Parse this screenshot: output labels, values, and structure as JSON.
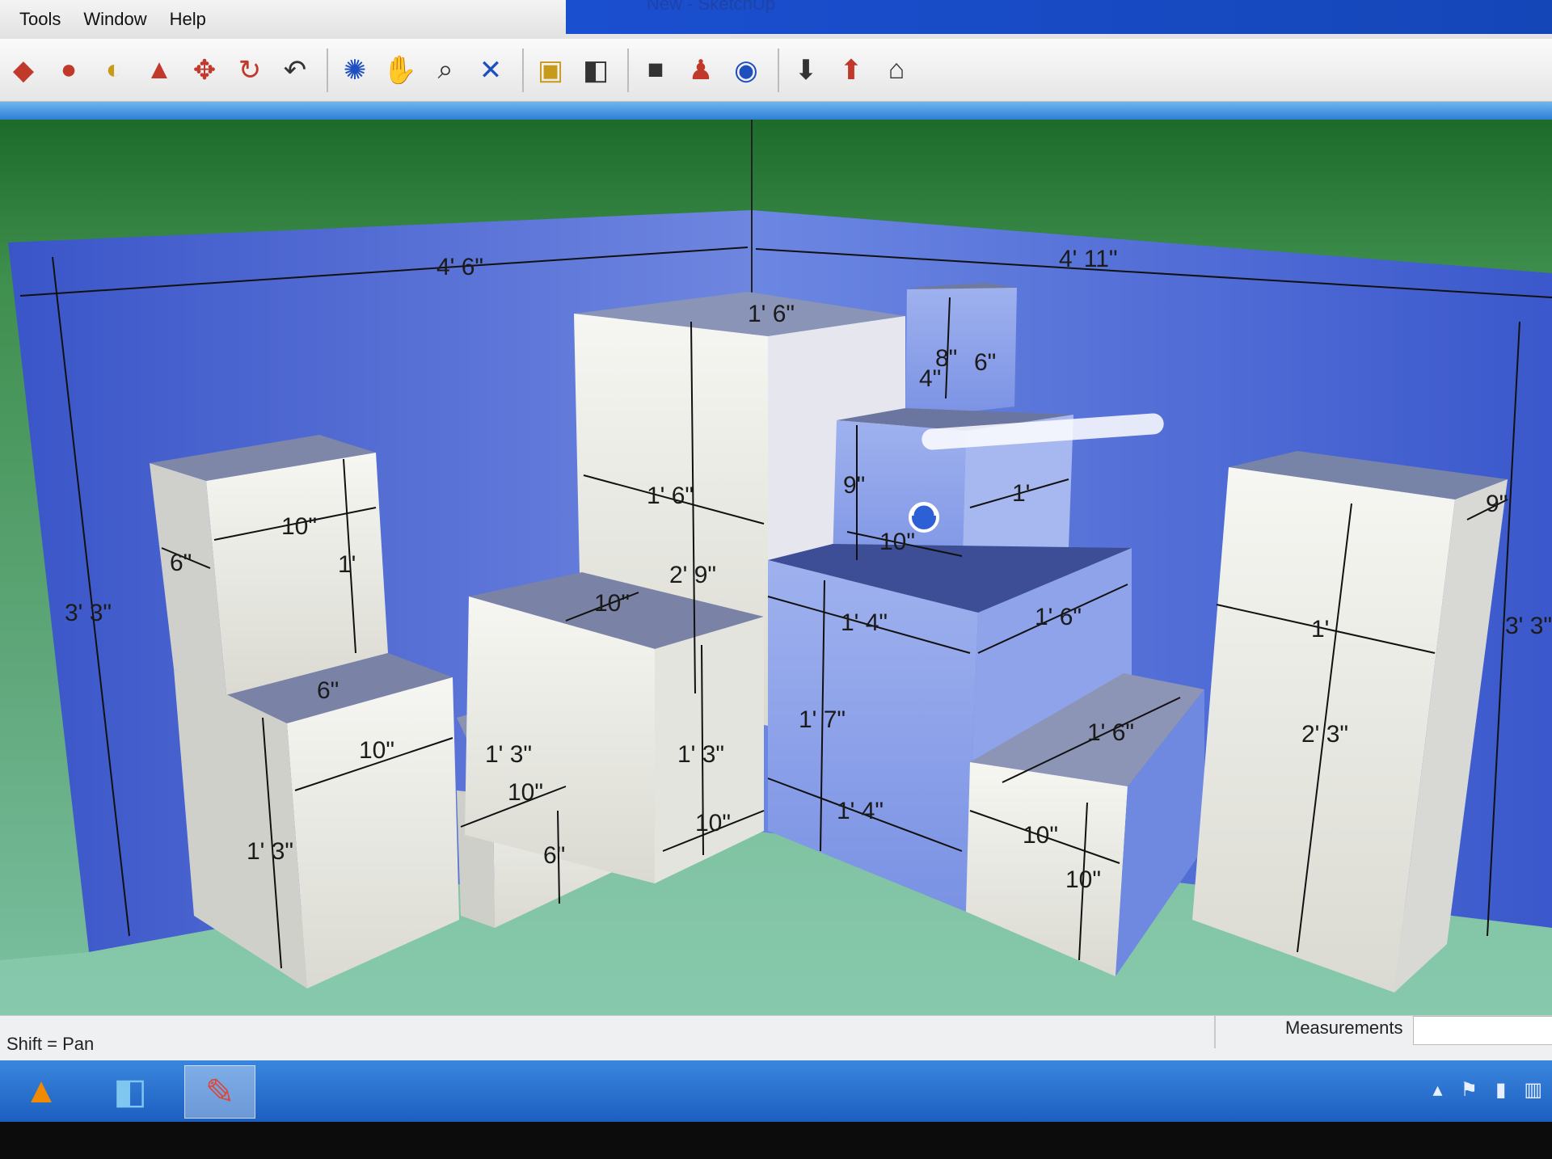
{
  "window": {
    "title": "New - SketchUp"
  },
  "menu": {
    "items": [
      "Tools",
      "Window",
      "Help"
    ]
  },
  "toolbar": {
    "tools": [
      {
        "name": "eraser-icon",
        "glyph": "◆",
        "tone": "red"
      },
      {
        "name": "paint-bucket-icon",
        "glyph": "●",
        "tone": "red"
      },
      {
        "name": "follow-me-icon",
        "glyph": "◐",
        "tone": "gold"
      },
      {
        "name": "push-pull-icon",
        "glyph": "▲",
        "tone": "red"
      },
      {
        "name": "move-icon",
        "glyph": "✥",
        "tone": "red"
      },
      {
        "name": "rotate-icon",
        "glyph": "↻",
        "tone": "red"
      },
      {
        "name": "offset-icon",
        "glyph": "↶",
        "tone": "dark"
      },
      {
        "name": "orbit-icon",
        "glyph": "✺",
        "tone": "blue"
      },
      {
        "name": "pan-icon",
        "glyph": "✋",
        "tone": "dark"
      },
      {
        "name": "zoom-icon",
        "glyph": "⌕",
        "tone": "dark"
      },
      {
        "name": "zoom-extents-icon",
        "glyph": "✕",
        "tone": "blue"
      },
      {
        "name": "previous-view-icon",
        "glyph": "▣",
        "tone": "gold"
      },
      {
        "name": "section-plane-icon",
        "glyph": "◧",
        "tone": "dark"
      },
      {
        "name": "3d-warehouse-icon",
        "glyph": "■",
        "tone": "dark"
      },
      {
        "name": "get-models-icon",
        "glyph": "♟",
        "tone": "red"
      },
      {
        "name": "share-model-icon",
        "glyph": "◉",
        "tone": "blue"
      },
      {
        "name": "get-components-icon",
        "glyph": "⬇",
        "tone": "dark"
      },
      {
        "name": "share-component-icon",
        "glyph": "⬆",
        "tone": "red"
      },
      {
        "name": "extension-warehouse-icon",
        "glyph": "⌂",
        "tone": "dark"
      }
    ]
  },
  "model": {
    "dimensions": {
      "overall_left": "4' 6\"",
      "overall_right": "4' 11\"",
      "overall_height_left": "3' 3\"",
      "overall_height_right": "3' 3\"",
      "tall_top": "1' 6\"",
      "tall_width": "1' 6\"",
      "tall_height": "2' 9\"",
      "top_cube_a": "4\"",
      "top_cube_b": "8\"",
      "top_cube_c": "6\"",
      "mid_cube_h": "9\"",
      "mid_cube_w": "10\"",
      "mid_cube_d": "1'",
      "left_upper_w": "10\"",
      "left_upper_d": "6\"",
      "left_upper_h": "1'",
      "left_lower_top": "6\"",
      "left_lower_w": "10\"",
      "left_lower_h": "1' 3\"",
      "step_top_a": "1' 3\"",
      "step_top_b": "10\"",
      "step_h": "6\"",
      "center_top": "10\"",
      "center_h": "1' 3\"",
      "center_w": "10\"",
      "blue_w": "1' 4\"",
      "blue_d": "1' 6\"",
      "blue_h": "1' 7\"",
      "blue_base": "1' 4\"",
      "right_step_top": "1' 6\"",
      "right_step_w": "10\"",
      "right_step_h": "10\"",
      "right_tall_w": "1'",
      "right_tall_d": "9\"",
      "right_tall_h": "2' 3\""
    }
  },
  "status": {
    "hint": "Shift = Pan",
    "measurements_label": "Measurements",
    "measurements_value": ""
  },
  "taskbar": {
    "apps": [
      {
        "name": "vlc-icon",
        "glyph": "▲"
      },
      {
        "name": "app-icon",
        "glyph": "◧"
      },
      {
        "name": "sketchup-icon",
        "glyph": "✎"
      }
    ],
    "tray": [
      {
        "name": "tray-arrow-icon",
        "glyph": "▴"
      },
      {
        "name": "flag-icon",
        "glyph": "⚑"
      },
      {
        "name": "battery-icon",
        "glyph": "▮"
      },
      {
        "name": "network-icon",
        "glyph": "▥"
      }
    ]
  }
}
